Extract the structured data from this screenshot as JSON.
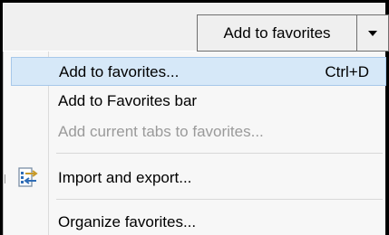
{
  "toolbar": {
    "favorites_button_label": "Add to favorites"
  },
  "menu": {
    "items": [
      {
        "label": "Add to favorites...",
        "shortcut": "Ctrl+D",
        "state": "highlighted"
      },
      {
        "label": "Add to Favorites bar",
        "state": "enabled"
      },
      {
        "label": "Add current tabs to favorites...",
        "state": "disabled"
      },
      {
        "label": "Import and export...",
        "icon": "import-export-icon",
        "state": "enabled"
      },
      {
        "label": "Organize favorites...",
        "state": "enabled"
      }
    ]
  },
  "colors": {
    "highlight_bg": "#d6e8f8",
    "highlight_border": "#a7c8ea",
    "disabled_text": "#9a9a9a",
    "icon_blue": "#2f6db6",
    "icon_gold": "#c79a2a"
  }
}
